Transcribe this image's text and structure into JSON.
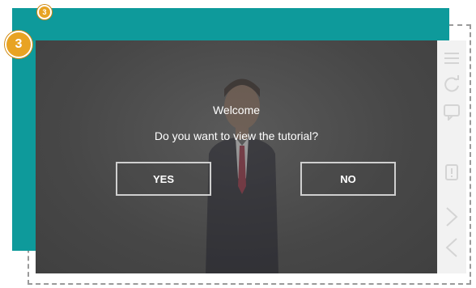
{
  "dialog": {
    "welcome_text": "Welcome",
    "question_text": "Do you want to view the tutorial?",
    "yes_label": "YES",
    "no_label": "NO"
  },
  "badges": {
    "small_badge_glyph": "3",
    "large_badge_glyph": "3"
  },
  "side_toolbar": {
    "icons": [
      "menu-icon",
      "refresh-icon",
      "chat-icon",
      "hint-icon",
      "next-icon",
      "back-icon"
    ]
  },
  "colors": {
    "teal": "#0e9a9b",
    "screen_bg": "#4a4a4a",
    "badge": "#e8a323",
    "side_icon": "#d9d9d9"
  }
}
